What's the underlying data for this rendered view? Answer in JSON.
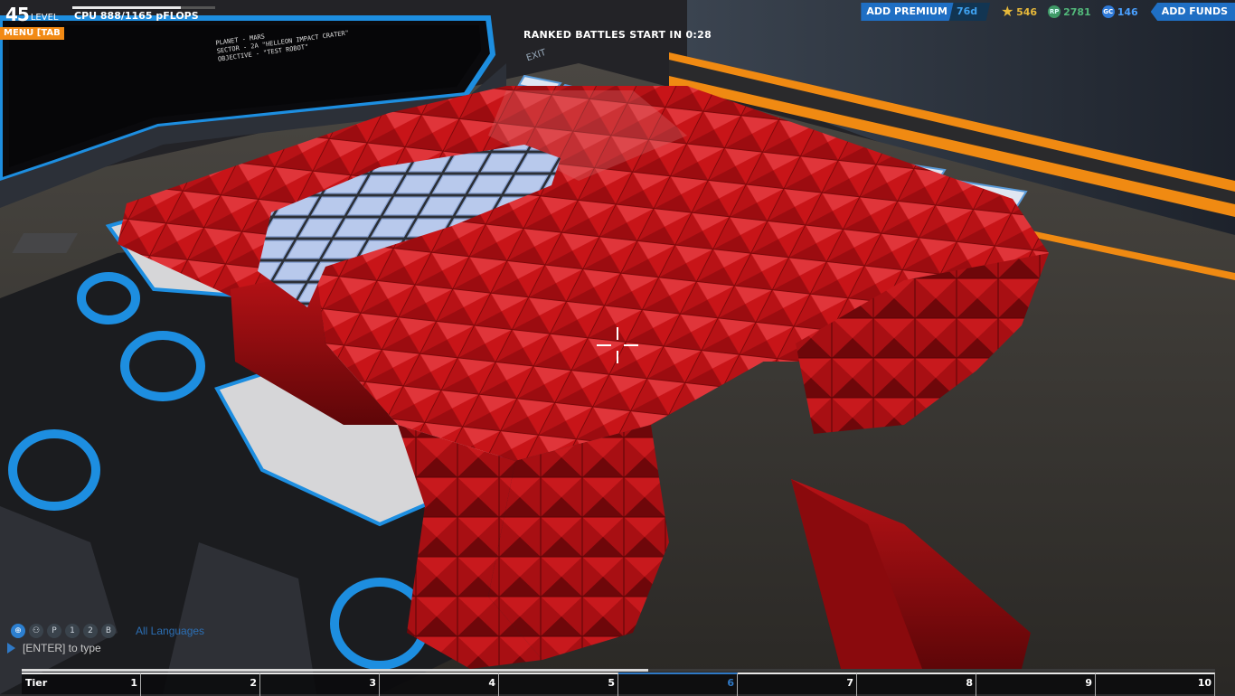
{
  "hud": {
    "level_number": "45",
    "level_label": "LEVEL",
    "cpu_text": "CPU 888/1165 pFLOPS",
    "cpu_fraction": 0.762,
    "menu_label": "MENU [TAB",
    "mission": {
      "planet": "PLANET - MARS",
      "sector": "SECTOR - 2A \"HELLEON IMPACT CRATER\"",
      "objective": "OBJECTIVE - \"TEST ROBOT\""
    },
    "exit_label": "EXIT"
  },
  "banner": {
    "ranked_text": "RANKED BATTLES START IN 0:28"
  },
  "topbar": {
    "add_premium_label": "ADD PREMIUM",
    "premium_days": "76d",
    "stars_value": "546",
    "rp_icon": "RP",
    "rp_value": "2781",
    "gc_icon": "GC",
    "gc_value": "146",
    "add_funds_label": "ADD FUNDS"
  },
  "chat": {
    "icons": [
      "globe-icon",
      "party-icon",
      "p-icon",
      "1-icon",
      "2-icon",
      "3-icon"
    ],
    "icon_glyphs": [
      "⊕",
      "⚇",
      "P",
      "1",
      "2",
      "B"
    ],
    "language": "All Languages",
    "input_hint": "[ENTER] to type"
  },
  "tier_bar": {
    "label": "Tier",
    "tiers": [
      "1",
      "2",
      "3",
      "4",
      "5",
      "6",
      "7",
      "8",
      "9",
      "10"
    ],
    "active_tier": "6",
    "progress_fraction": 0.525
  },
  "colors": {
    "accent_blue": "#1f6fc4",
    "menu_orange": "#f28a14",
    "robot_red": "#c81418",
    "star_gold": "#e6b83a",
    "rp_green": "#52b87a",
    "gc_blue": "#4aa0ff"
  }
}
